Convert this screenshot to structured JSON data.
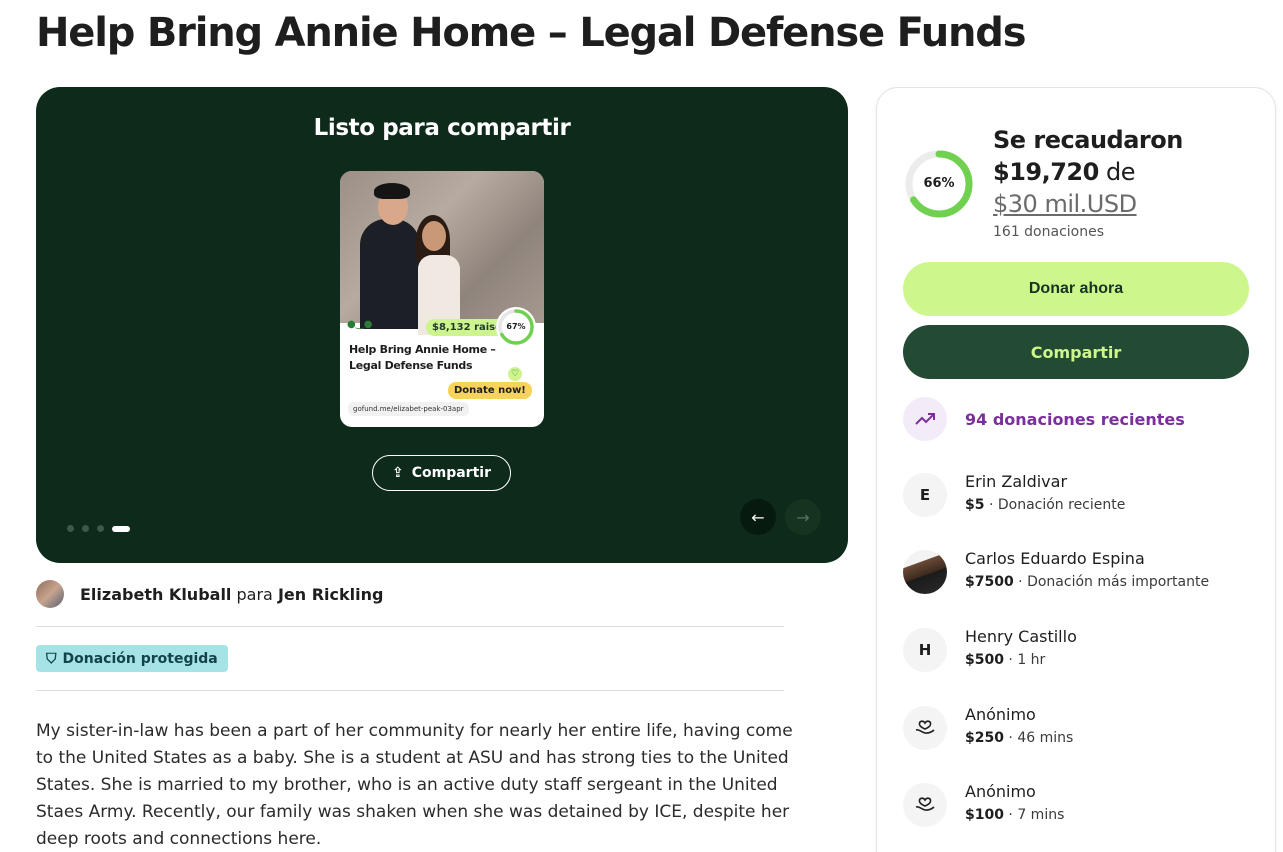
{
  "page": {
    "title": "Help Bring Annie Home – Legal Defense Funds"
  },
  "hero": {
    "heading": "Listo para compartir",
    "share_label": "Compartir",
    "card": {
      "raised_badge": "$8,132 raised",
      "percent": "67%",
      "percent_value": 0.67,
      "title": "Help Bring Annie Home – Legal Defense Funds",
      "donate_label": "Donate now!",
      "url": "gofund.me/elizabet-peak-03apr"
    },
    "slides": 4,
    "active_slide": 4
  },
  "organizer": {
    "name": "Elizabeth Kluball",
    "connector": "para",
    "beneficiary": "Jen Rickling"
  },
  "protected_badge": "Donación protegida",
  "story": "My sister-in-law has been a part of her community for nearly her entire life, having come to the United States as a baby. She is a student at ASU and has strong ties to the United States. She is married to my brother, who is an active duty staff sergeant in the United Staes Army. Recently, our family was shaken when she was detained by ICE, despite her deep roots and connections here.",
  "panel": {
    "progress_percent": "66%",
    "progress_value": 0.66,
    "raised_label": "Se recaudaron",
    "raised_amount": "$19,720",
    "of_label": "de",
    "goal": "$30 mil.USD",
    "donation_count": "161 donaciones",
    "donate_button": "Donar ahora",
    "share_button": "Compartir",
    "recent_label": "94 donaciones recientes",
    "colors": {
      "donate_bg": "#cdf78c",
      "share_bg": "#234a33",
      "accent_purple": "#7a2f9c",
      "progress_green": "#6fd14f"
    }
  },
  "donors": [
    {
      "initial": "E",
      "name": "Erin Zaldivar",
      "amount": "$5",
      "sep": "·",
      "detail": "Donación reciente",
      "avatar": "initial"
    },
    {
      "initial": "",
      "name": "Carlos Eduardo Espina",
      "amount": "$7500",
      "sep": "·",
      "detail": "Donación más importante",
      "avatar": "photo"
    },
    {
      "initial": "H",
      "name": "Henry Castillo",
      "amount": "$500",
      "sep": "·",
      "detail": "1 hr",
      "avatar": "initial"
    },
    {
      "initial": "",
      "name": "Anónimo",
      "amount": "$250",
      "sep": "·",
      "detail": "46 mins",
      "avatar": "hand-heart-icon"
    },
    {
      "initial": "",
      "name": "Anónimo",
      "amount": "$100",
      "sep": "·",
      "detail": "7 mins",
      "avatar": "hand-heart-icon"
    }
  ]
}
